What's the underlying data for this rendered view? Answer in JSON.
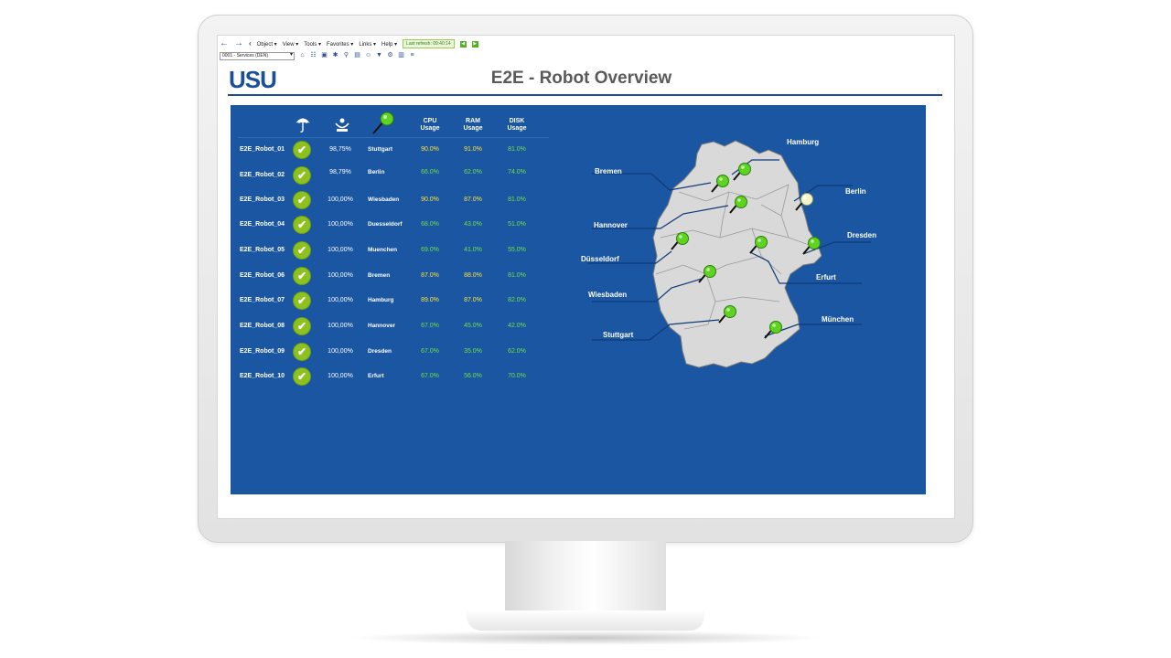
{
  "toolbar": {
    "menu": [
      "Object ▾",
      "View ▾",
      "Tools ▾",
      "Favorites ▾",
      "Links ▾",
      "Help ▾"
    ],
    "last_refresh": "Last refresh: 09:40:14",
    "context_select": "0001 - Services (DEN)"
  },
  "header": {
    "logo": "USU",
    "title": "E2E - Robot Overview"
  },
  "table": {
    "columns": {
      "status_icon": "umbrella-icon",
      "availability_icon": "availability-icon",
      "location_icon": "map-pin-icon",
      "cpu": [
        "CPU",
        "Usage"
      ],
      "ram": [
        "RAM",
        "Usage"
      ],
      "disk": [
        "DISK",
        "Usage"
      ]
    },
    "rows": [
      {
        "robot": "E2E_Robot_01",
        "availability": "98,75%",
        "location": "Stuttgart",
        "cpu": "90.0%",
        "ram": "91.0%",
        "disk": "81.0%"
      },
      {
        "robot": "E2E_Robot_02",
        "availability": "98,79%",
        "location": "Berlin",
        "cpu": "66.0%",
        "ram": "62.0%",
        "disk": "74.0%"
      },
      {
        "robot": "E2E_Robot_03",
        "availability": "100,00%",
        "location": "Wiesbaden",
        "cpu": "90.0%",
        "ram": "87.0%",
        "disk": "81.0%"
      },
      {
        "robot": "E2E_Robot_04",
        "availability": "100,00%",
        "location": "Duesseldorf",
        "cpu": "68.0%",
        "ram": "43.0%",
        "disk": "51.0%"
      },
      {
        "robot": "E2E_Robot_05",
        "availability": "100,00%",
        "location": "Muenchen",
        "cpu": "69.0%",
        "ram": "41.0%",
        "disk": "55.0%"
      },
      {
        "robot": "E2E_Robot_06",
        "availability": "100,00%",
        "location": "Bremen",
        "cpu": "87.0%",
        "ram": "88.0%",
        "disk": "81.0%"
      },
      {
        "robot": "E2E_Robot_07",
        "availability": "100,00%",
        "location": "Hamburg",
        "cpu": "89.0%",
        "ram": "87.0%",
        "disk": "82.0%"
      },
      {
        "robot": "E2E_Robot_08",
        "availability": "100,00%",
        "location": "Hannover",
        "cpu": "67.0%",
        "ram": "45.0%",
        "disk": "42.0%"
      },
      {
        "robot": "E2E_Robot_09",
        "availability": "100,00%",
        "location": "Dresden",
        "cpu": "67.0%",
        "ram": "35.0%",
        "disk": "62.0%"
      },
      {
        "robot": "E2E_Robot_10",
        "availability": "100,00%",
        "location": "Erfurt",
        "cpu": "67.0%",
        "ram": "56.0%",
        "disk": "70.0%"
      }
    ]
  },
  "map": {
    "labels": {
      "hamburg": "Hamburg",
      "bremen": "Bremen",
      "berlin": "Berlin",
      "hannover": "Hannover",
      "dresden": "Dresden",
      "duesseldorf": "Düsseldorf",
      "erfurt": "Erfurt",
      "wiesbaden": "Wiesbaden",
      "muenchen": "München",
      "stuttgart": "Stuttgart"
    }
  },
  "colors": {
    "panel": "#1a56a1",
    "ok": "#8cc11f",
    "high": "#ffe23a",
    "normal": "#6fe04a",
    "pin_ok": "#5fd321",
    "pin_warn": "#f2f5c8"
  }
}
